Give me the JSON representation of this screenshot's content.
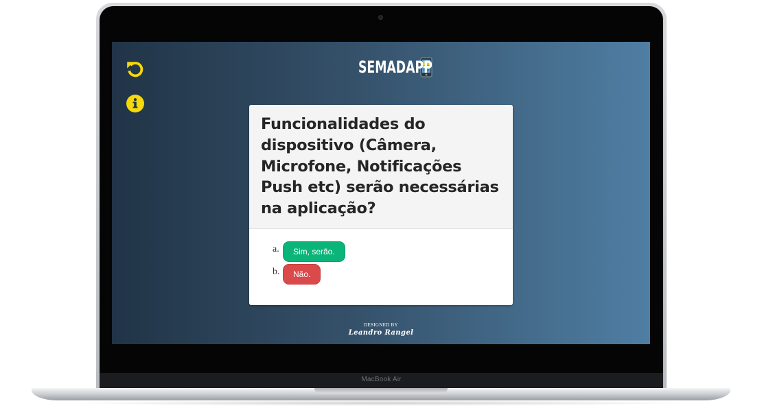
{
  "device": {
    "label": "MacBook Air"
  },
  "app": {
    "title": "SEMADAPP",
    "logo_icon": "phone-icon"
  },
  "toolbar": {
    "restart_icon": "restart-icon",
    "info_icon": "info-icon",
    "accent_color": "#f5d90a"
  },
  "question": {
    "text": "Funcionalidades do dispositivo (Câmera, Microfone, Notificações Push etc) serão necessárias na aplicação?"
  },
  "answers": [
    {
      "letter": "a.",
      "label": "Sim, serão.",
      "color": "#0bb57a"
    },
    {
      "letter": "b.",
      "label": "Não.",
      "color": "#db4a4a"
    }
  ],
  "footer": {
    "designed_by": "DESIGNED BY",
    "author": "Leandro Rangel"
  }
}
